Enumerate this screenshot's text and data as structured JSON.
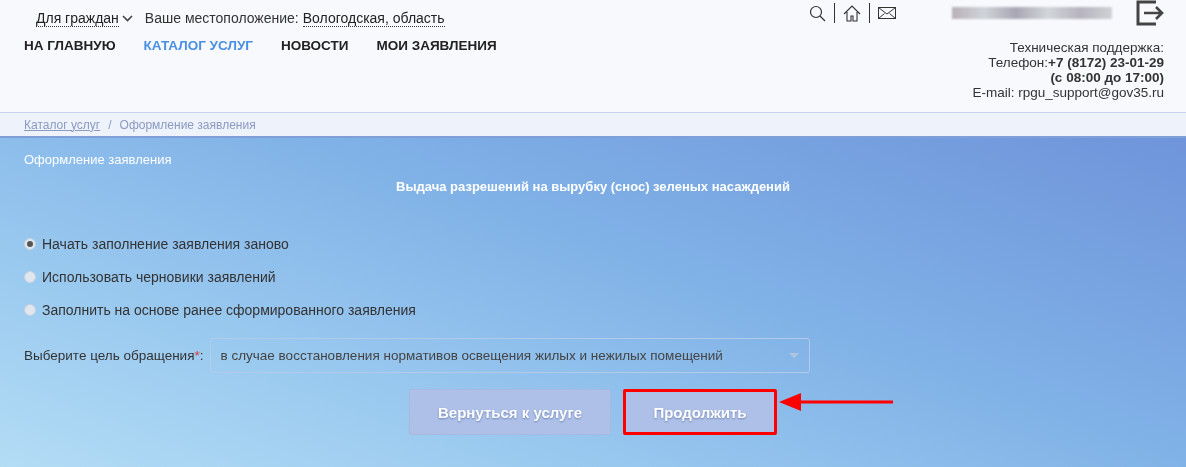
{
  "header": {
    "audience": "Для граждан",
    "location_label": "Ваше местоположение:",
    "location": "Вологодская, область"
  },
  "nav": [
    {
      "label": "НА ГЛАВНУЮ",
      "selected": false
    },
    {
      "label": "КАТАЛОГ УСЛУГ",
      "selected": true
    },
    {
      "label": "НОВОСТИ",
      "selected": false
    },
    {
      "label": "МОИ ЗАЯВЛЕНИЯ",
      "selected": false
    }
  ],
  "support": {
    "title": "Техническая поддержка:",
    "phone": "Телефон:**+7 (8172) 23-01-29**",
    "hours": "(с 08:00 до 17:00)",
    "email": "E-mail: rpgu_support@gov35.ru"
  },
  "breadcrumbs": [
    {
      "label": "Каталог услуг",
      "link": true
    },
    {
      "label": "Оформление заявления",
      "link": false
    }
  ],
  "breadcrumb_separator": "/",
  "page_title": "Оформление заявления",
  "service_title": "Выдача разрешений на вырубку (снос) зеленых насаждений",
  "options": [
    {
      "label": "Начать заполнение заявления заново",
      "selected": true
    },
    {
      "label": "Использовать черновики заявлений",
      "selected": false
    },
    {
      "label": "Заполнить на основе ранее сформированного заявления",
      "selected": false
    }
  ],
  "purpose": {
    "label": "Выберите цель обращения",
    "required_mark": "*",
    "suffix": ":",
    "value": "в случае восстановления нормативов освещения жилых и нежилых помещений"
  },
  "buttons": [
    {
      "label": "Вернуться к услуге",
      "highlighted": false
    },
    {
      "label": "Продолжить",
      "highlighted": true
    }
  ]
}
